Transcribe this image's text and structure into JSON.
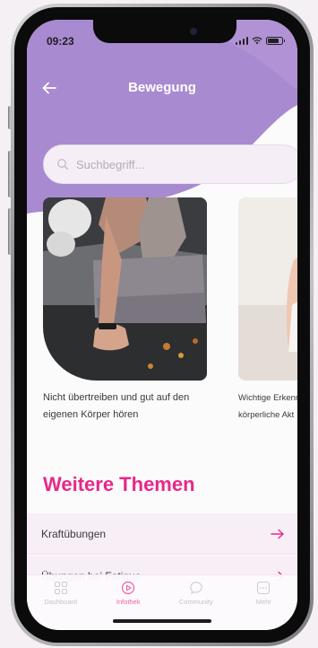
{
  "status": {
    "time": "09:23"
  },
  "header": {
    "title": "Bewegung"
  },
  "search": {
    "placeholder": "Suchbegriff..."
  },
  "articles": [
    {
      "caption": "Nicht übertreiben und gut auf den eigenen Körper hören"
    },
    {
      "caption_line1": "Wichtige Erkenn",
      "caption_line2": "körperliche Akt"
    }
  ],
  "section": {
    "title": "Weitere Themen"
  },
  "topics": [
    {
      "label": "Kraftübungen"
    },
    {
      "label": "Übungen bei Fatigue"
    }
  ],
  "tabs": [
    {
      "label": "Dashboard",
      "icon": "grid-icon",
      "active": false
    },
    {
      "label": "Infothek",
      "icon": "play-circle-icon",
      "active": true
    },
    {
      "label": "Community",
      "icon": "chat-bubble-icon",
      "active": false
    },
    {
      "label": "Mehr",
      "icon": "more-icon",
      "active": false
    }
  ],
  "colors": {
    "header_purple": "#a88ad0",
    "accent_pink": "#e6288a",
    "topic_bg": "#f8eef6"
  }
}
